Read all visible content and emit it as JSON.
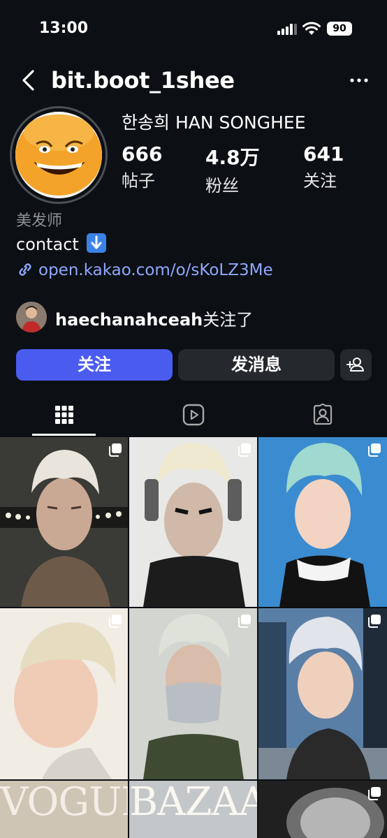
{
  "status_bar": {
    "time": "13:00",
    "battery": "90"
  },
  "header": {
    "username": "bit.boot_1shee"
  },
  "profile": {
    "full_name": "한송희 HAN SONGHEE",
    "stats": [
      {
        "value": "666",
        "label": "帖子"
      },
      {
        "value": "4.8万",
        "label": "粉丝"
      },
      {
        "value": "641",
        "label": "关注"
      }
    ],
    "category": "美发师",
    "bio": "contact",
    "bio_emoji": "down-arrow-emoji",
    "link": "open.kakao.com/o/sKoLZ3Me",
    "followed_by_user": "haechanahceah",
    "followed_by_suffix": "关注了"
  },
  "actions": {
    "follow": "关注",
    "message": "发消息"
  },
  "tabs": [
    "grid-icon",
    "reels-icon",
    "tagged-icon"
  ],
  "grid": {
    "magazines": [
      "VOGUE",
      "BAZAAR"
    ]
  },
  "colors": {
    "follow_button": "#4a5cf0",
    "link": "#8fa8ff",
    "background": "#0c1014"
  }
}
